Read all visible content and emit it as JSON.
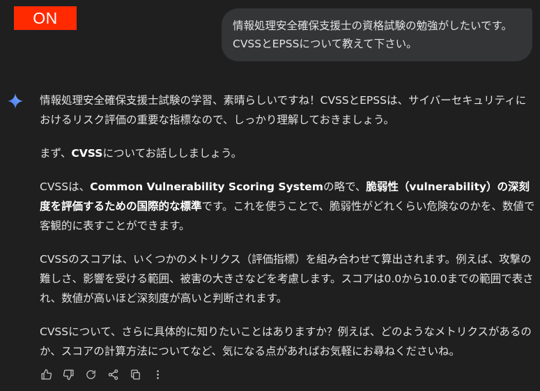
{
  "badge": {
    "label": "ON",
    "color": "#ff2a00"
  },
  "user_message": {
    "line1": "情報処理安全確保支援士の資格試験の勉強がしたいです。",
    "line2": "CVSSとEPSSについて教えて下さい。"
  },
  "answer": {
    "icon": "sparkle-icon",
    "p1": "情報処理安全確保支援士試験の学習、素晴らしいですね！CVSSとEPSSは、サイバーセキュリティにおけるリスク評価の重要な指標なので、しっかり理解しておきましょう。",
    "p2": {
      "pre": "まず、",
      "bold": "CVSS",
      "post": "についてお話ししましょう。"
    },
    "p3": {
      "t1": "CVSSは、",
      "b1": "Common Vulnerability Scoring System",
      "t2": "の略で、",
      "b2": "脆弱性（vulnerability）の深刻度を評価するための国際的な標準",
      "t3": "です。これを使うことで、脆弱性がどれくらい危険なのかを、数値で客観的に表すことができます。"
    },
    "p4": "CVSSのスコアは、いくつかのメトリクス（評価指標）を組み合わせて算出されます。例えば、攻撃の難しさ、影響を受ける範囲、被害の大きさなどを考慮します。スコアは0.0から10.0までの範囲で表され、数値が高いほど深刻度が高いと判断されます。",
    "p5": "CVSSについて、さらに具体的に知りたいことはありますか？例えば、どのようなメトリクスがあるのか、スコアの計算方法についてなど、気になる点があればお気軽にお尋ねくださいね。"
  },
  "actions": [
    "thumbs-up-icon",
    "thumbs-down-icon",
    "regenerate-icon",
    "share-icon",
    "copy-icon",
    "more-vert-icon"
  ]
}
